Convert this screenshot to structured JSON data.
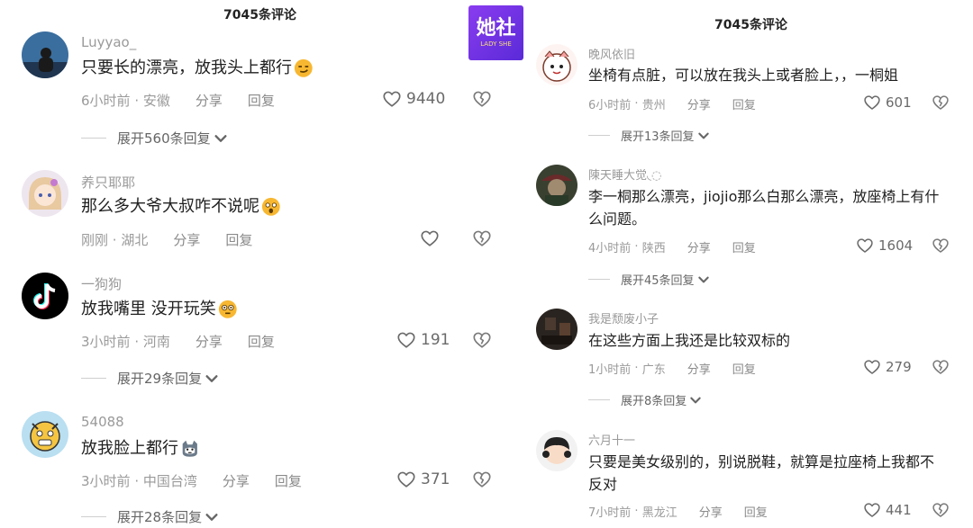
{
  "left": {
    "header": "7045条评论",
    "comments": [
      {
        "user": "Luyyao_",
        "text": "只要长的漂亮，放我头上都行",
        "time": "6小时前",
        "location": "安徽",
        "share": "分享",
        "reply": "回复",
        "likes": "9440",
        "expand": "展开560条回复"
      },
      {
        "user": "养只耶耶",
        "text": "那么多大爷大叔咋不说呢",
        "time": "刚刚",
        "location": "湖北",
        "share": "分享",
        "reply": "回复",
        "likes": "",
        "expand": ""
      },
      {
        "user": "一狗狗",
        "text": "放我嘴里 没开玩笑",
        "time": "3小时前",
        "location": "河南",
        "share": "分享",
        "reply": "回复",
        "likes": "191",
        "expand": "展开29条回复"
      },
      {
        "user": "54088",
        "text": "放我脸上都行",
        "time": "3小时前",
        "location": "中国台湾",
        "share": "分享",
        "reply": "回复",
        "likes": "371",
        "expand": "展开28条回复"
      }
    ]
  },
  "right": {
    "header": "7045条评论",
    "comments": [
      {
        "user": "晚风依旧",
        "text": "坐椅有点脏，可以放在我头上或者脸上，，一桐姐",
        "time": "6小时前",
        "location": "贵州",
        "share": "分享",
        "reply": "回复",
        "likes": "601",
        "expand": "展开13条回复"
      },
      {
        "user": "陳天睡大觉◟◌",
        "text": "李一桐那么漂亮，jiojio那么白那么漂亮，放座椅上有什么问题。",
        "time": "4小时前",
        "location": "陕西",
        "share": "分享",
        "reply": "回复",
        "likes": "1604",
        "expand": "展开45条回复"
      },
      {
        "user": "我是颓废小子",
        "text": "在这些方面上我还是比较双标的",
        "time": "1小时前",
        "location": "广东",
        "share": "分享",
        "reply": "回复",
        "likes": "279",
        "expand": "展开8条回复"
      },
      {
        "user": "六月十一",
        "text": "只要是美女级别的，别说脱鞋，就算是拉座椅上我都不反对",
        "time": "7小时前",
        "location": "黑龙江",
        "share": "分享",
        "reply": "回复",
        "likes": "441",
        "expand": ""
      }
    ]
  },
  "logo": {
    "main": "她社",
    "sub": "LADY SHE"
  },
  "icons": {
    "like": "heart-outline-icon",
    "dislike": "broken-heart-icon",
    "expand": "chevron-down-icon"
  }
}
